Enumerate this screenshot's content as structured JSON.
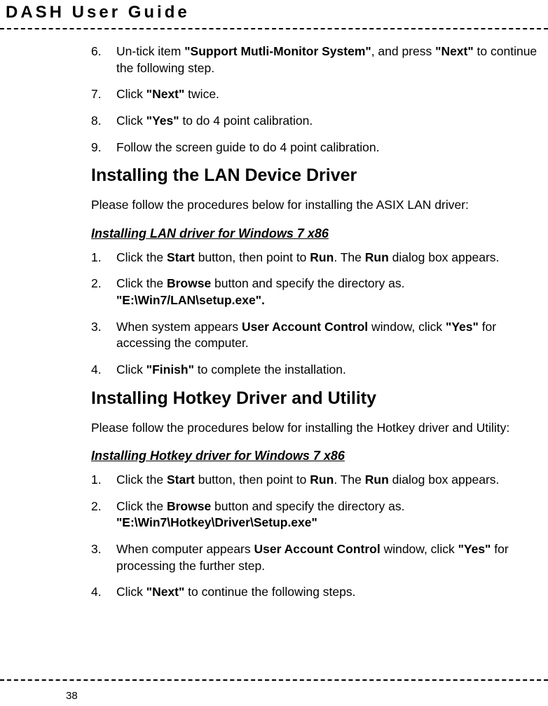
{
  "header": {
    "title": "DASH  User  Guide"
  },
  "section1": {
    "items": [
      {
        "num": "6.",
        "prefix": "Un-tick item ",
        "bold1": "\"Support Mutli-Monitor System\"",
        "mid": ", and press ",
        "bold2": "\"Next\"",
        "suffix": " to continue the following step."
      },
      {
        "num": "7.",
        "prefix": "Click ",
        "bold1": "\"Next\"",
        "suffix": " twice."
      },
      {
        "num": "8.",
        "prefix": "Click ",
        "bold1": "\"Yes\"",
        "suffix": " to do 4 point calibration."
      },
      {
        "num": "9.",
        "text": "Follow the screen guide to do 4 point calibration."
      }
    ]
  },
  "section2": {
    "heading": "Installing the LAN Device Driver",
    "intro": "Please follow the procedures below for installing the ASIX LAN driver:",
    "sub": "Installing LAN driver for Windows 7 x86",
    "items": [
      {
        "num": "1.",
        "prefix": "Click the ",
        "bold1": "Start",
        "mid1": " button, then point to ",
        "bold2": "Run",
        "mid2": ". The ",
        "bold3": "Run",
        "suffix": " dialog box appears."
      },
      {
        "num": "2.",
        "prefix": "Click the ",
        "bold1": "Browse",
        "mid1": " button and specify the directory as.",
        "line2bold": "\"E:\\Win7/LAN\\setup.exe\"."
      },
      {
        "num": "3.",
        "prefix": "When system appears ",
        "bold1": "User Account Control",
        "mid1": " window, click ",
        "bold2": "\"Yes\"",
        "suffix": " for accessing the computer."
      },
      {
        "num": "4.",
        "prefix": "Click ",
        "bold1": "\"Finish\"",
        "suffix": " to complete the installation."
      }
    ]
  },
  "section3": {
    "heading": "Installing Hotkey Driver and Utility",
    "intro": "Please follow the procedures below for installing the Hotkey driver and Utility:",
    "sub": "Installing Hotkey driver for Windows 7 x86",
    "items": [
      {
        "num": "1.",
        "prefix": "Click the ",
        "bold1": "Start",
        "mid1": " button, then point to ",
        "bold2": "Run",
        "mid2": ". The ",
        "bold3": "Run",
        "suffix": " dialog box appears."
      },
      {
        "num": "2.",
        "prefix": "Click the ",
        "bold1": "Browse",
        "mid1": " button and specify the directory as.",
        "line2bold": "\"E:\\Win7\\Hotkey\\Driver\\Setup.exe\""
      },
      {
        "num": "3.",
        "prefix": "When computer appears ",
        "bold1": "User Account Control",
        "mid1": " window, click ",
        "bold2": "\"Yes\"",
        "suffix": " for processing the further step."
      },
      {
        "num": "4.",
        "prefix": "Click ",
        "bold1": "\"Next\"",
        "suffix": " to continue the following steps."
      }
    ]
  },
  "pageNumber": "38"
}
